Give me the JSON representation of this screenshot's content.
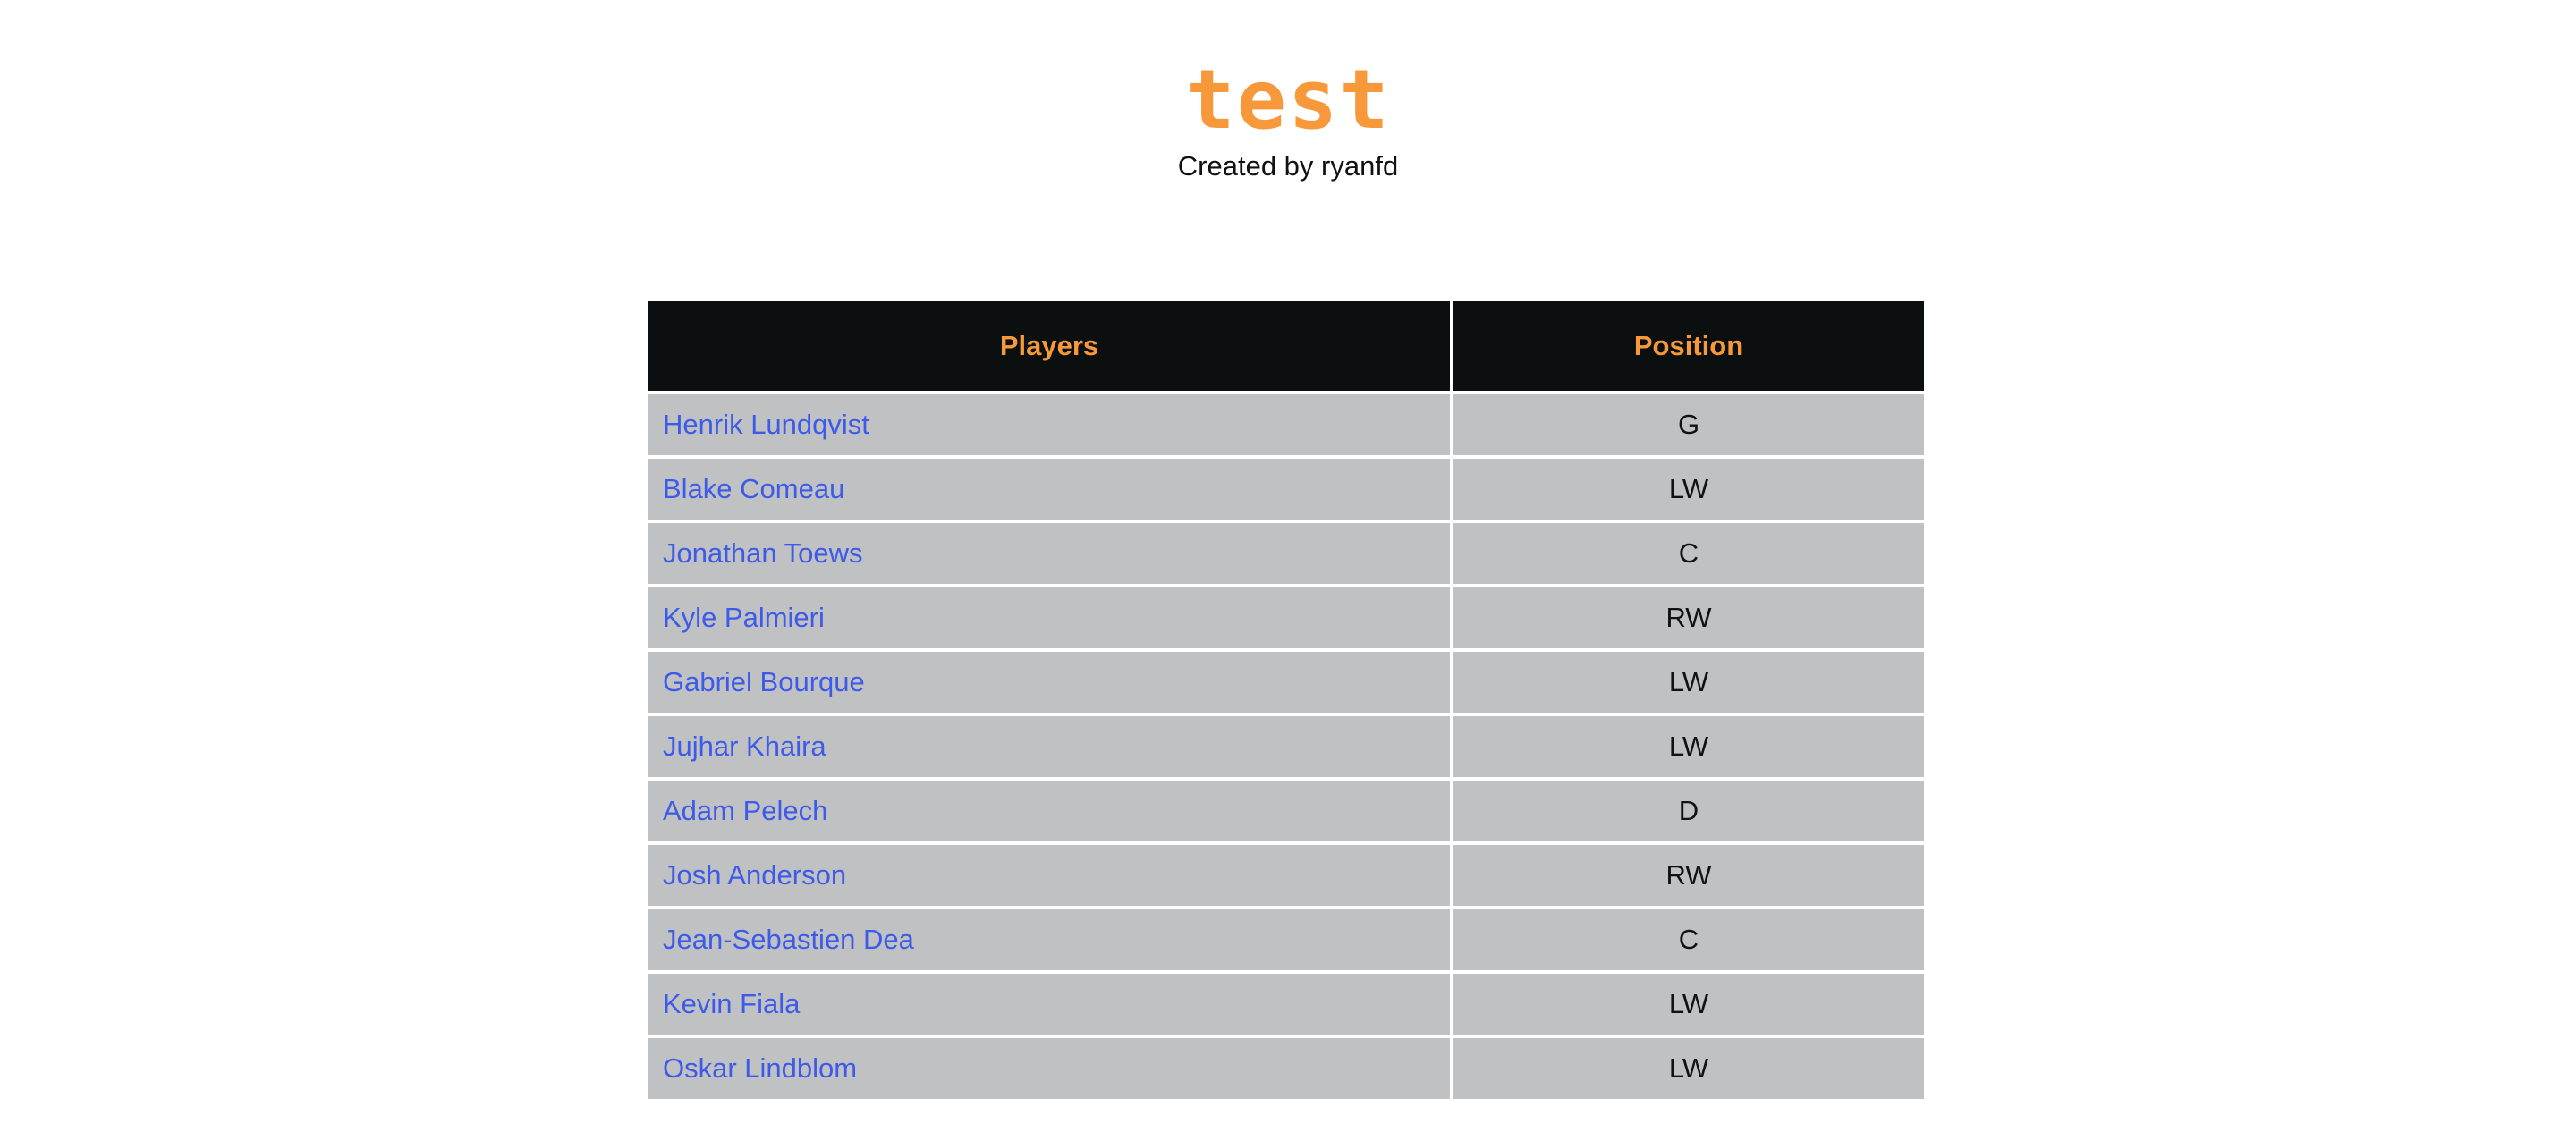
{
  "header": {
    "title": "test",
    "subtitle": "Created by ryanfd"
  },
  "table": {
    "columns": [
      "Players",
      "Position"
    ],
    "rows": [
      {
        "player": "Henrik Lundqvist",
        "position": "G"
      },
      {
        "player": "Blake Comeau",
        "position": "LW"
      },
      {
        "player": "Jonathan Toews",
        "position": "C"
      },
      {
        "player": "Kyle Palmieri",
        "position": "RW"
      },
      {
        "player": "Gabriel Bourque",
        "position": "LW"
      },
      {
        "player": "Jujhar Khaira",
        "position": "LW"
      },
      {
        "player": "Adam Pelech",
        "position": "D"
      },
      {
        "player": "Josh Anderson",
        "position": "RW"
      },
      {
        "player": "Jean-Sebastien Dea",
        "position": "C"
      },
      {
        "player": "Kevin Fiala",
        "position": "LW"
      },
      {
        "player": "Oskar Lindblom",
        "position": "LW"
      }
    ]
  },
  "colors": {
    "accent": "#F7983A",
    "link": "#3D5AE8",
    "header_bg": "#0B0F0F",
    "row_bg": "#C0C1C3"
  }
}
